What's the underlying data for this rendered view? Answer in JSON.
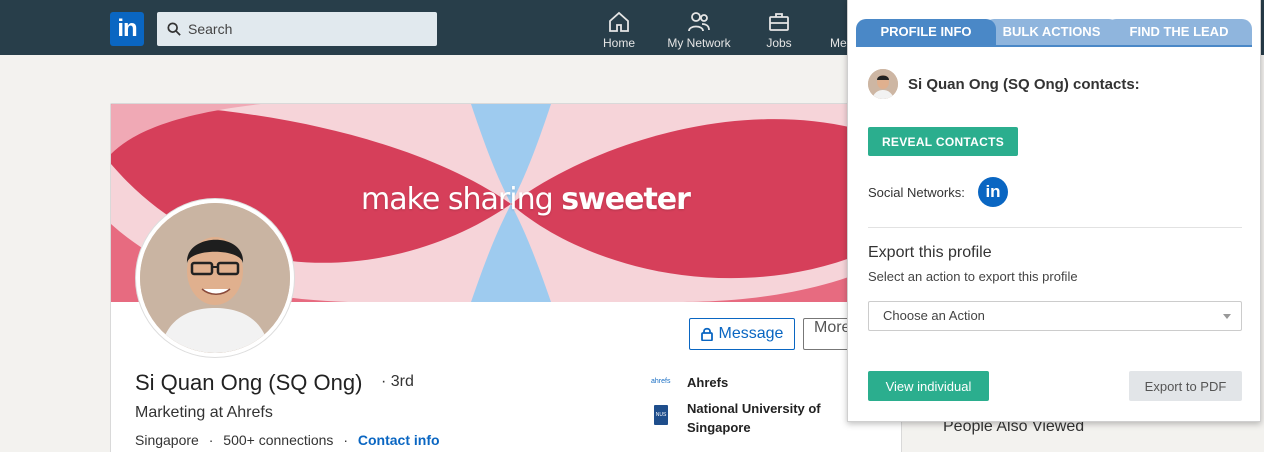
{
  "nav": {
    "logo": "in",
    "search_placeholder": "Search",
    "items": [
      {
        "label": "Home"
      },
      {
        "label": "My Network"
      },
      {
        "label": "Jobs"
      },
      {
        "label": "Me"
      }
    ]
  },
  "profile": {
    "banner_text_1": "make sharing ",
    "banner_text_2": "sweeter",
    "name": "Si Quan Ong (SQ Ong)",
    "degree": "· 3rd",
    "headline": "Marketing at Ahrefs",
    "location": "Singapore",
    "sep": "·",
    "connections": "500+ connections",
    "contact_info": "Contact info",
    "message_label": "Message",
    "more_label": "More",
    "company": "Ahrefs",
    "company_logo_text": "ahrefs",
    "school_line1": "National University of",
    "school_line2": "Singapore",
    "school_logo_text": "NUS"
  },
  "sidebar": {
    "people_also_viewed": "People Also Viewed"
  },
  "panel": {
    "tabs": [
      {
        "label": "PROFILE INFO"
      },
      {
        "label": "BULK ACTIONS"
      },
      {
        "label": "FIND THE LEAD"
      }
    ],
    "contact_title": "Si Quan Ong (SQ Ong) contacts:",
    "reveal_label": "REVEAL CONTACTS",
    "social_label": "Social Networks:",
    "social_icon_text": "in",
    "export_title": "Export this profile",
    "export_sub": "Select an action to export this profile",
    "select_value": "Choose an Action",
    "view_label": "View individual",
    "pdf_label": "Export to PDF"
  },
  "colors": {
    "nav_bg": "#283e4a",
    "linkedin_blue": "#0a66c2",
    "tab_active": "#4a88c7",
    "tab_inactive": "#8fb5dd",
    "green_button": "#2bae8e",
    "banner_red": "#d63f5a",
    "banner_blue": "#9ecbef"
  }
}
